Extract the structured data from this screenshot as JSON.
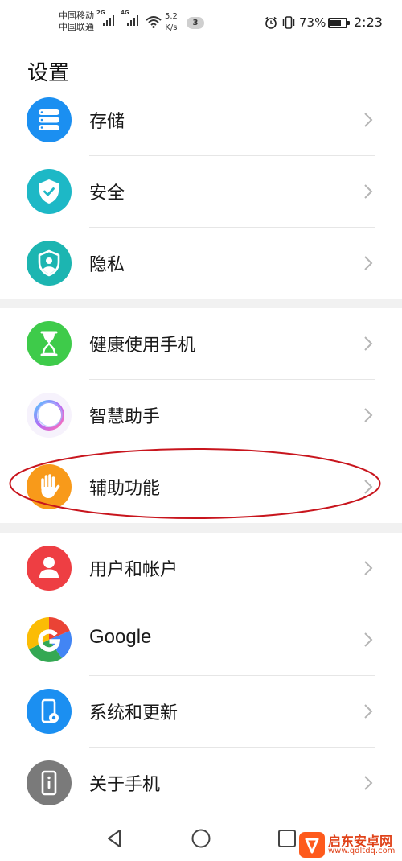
{
  "status_bar": {
    "carrier_1": "中国移动",
    "carrier_2": "中国联通",
    "network_1": "2G",
    "network_2": "4G",
    "speed_value": "5.2",
    "speed_unit": "K/s",
    "notification_count": "3",
    "battery_percent": "73%",
    "battery_level": 0.73,
    "time": "2:23"
  },
  "page": {
    "title": "设置"
  },
  "settings": {
    "storage": {
      "label": "存储",
      "icon": "storage-icon",
      "color": "#1b8ff1"
    },
    "security": {
      "label": "安全",
      "icon": "shield-check-icon",
      "color": "#1db8c6"
    },
    "privacy": {
      "label": "隐私",
      "icon": "privacy-shield-icon",
      "color": "#1cb5b1"
    },
    "digital_balance": {
      "label": "健康使用手机",
      "icon": "hourglass-icon",
      "color": "#3ecb4a"
    },
    "assistant": {
      "label": "智慧助手",
      "icon": "assistant-ring-icon",
      "color": "#9b7bf2"
    },
    "accessibility": {
      "label": "辅助功能",
      "icon": "hand-icon",
      "color": "#f89a1a"
    },
    "users": {
      "label": "用户和帐户",
      "icon": "user-icon",
      "color": "#ee3e43"
    },
    "google": {
      "label": "Google",
      "icon": "google-icon",
      "color": "#4285f4"
    },
    "system": {
      "label": "系统和更新",
      "icon": "phone-settings-icon",
      "color": "#1b8ff1"
    },
    "about": {
      "label": "关于手机",
      "icon": "phone-info-icon",
      "color": "#7a7a7a"
    }
  },
  "annotation": {
    "color": "#c8151d"
  },
  "navigation": {
    "back_icon": "back-icon",
    "home_icon": "home-icon",
    "recents_icon": "recents-icon"
  },
  "watermark": {
    "name": "启东安卓网",
    "url": "www.qdltdq.com"
  }
}
